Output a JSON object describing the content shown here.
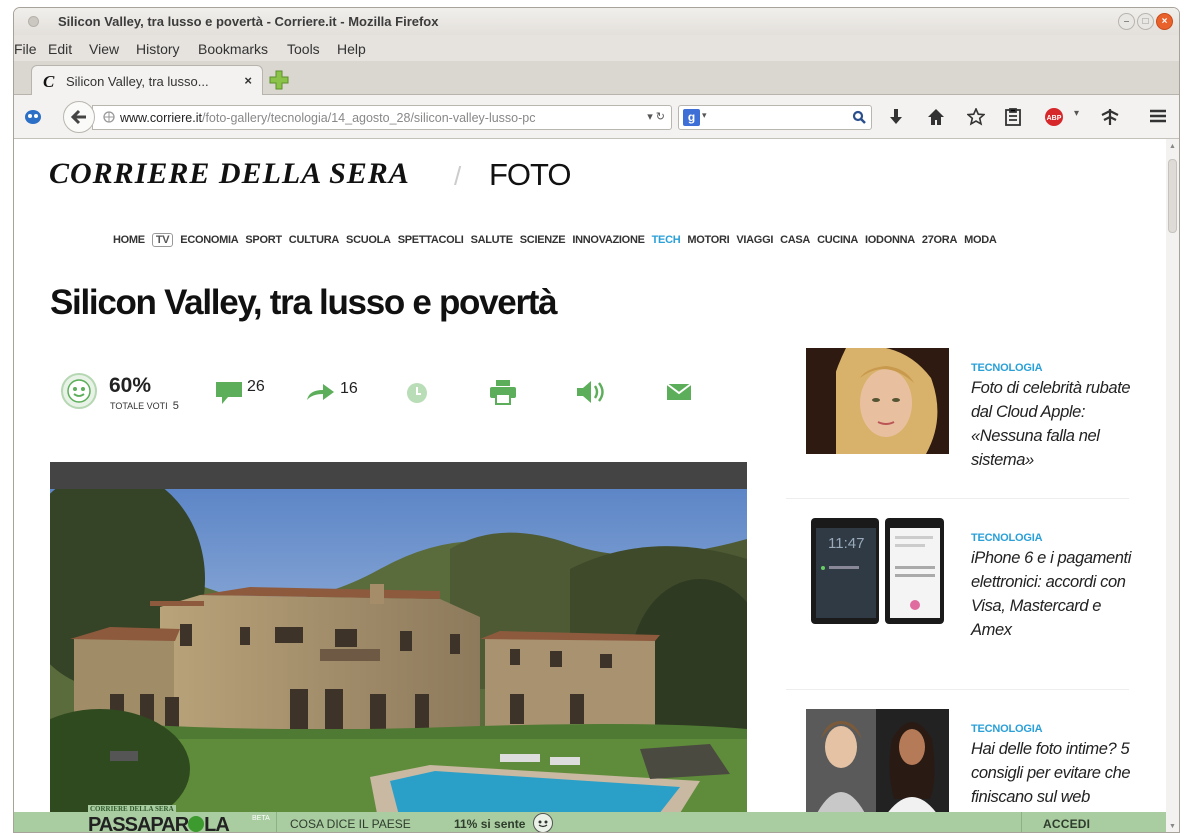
{
  "window": {
    "title": "Silicon Valley, tra lusso e povertà - Corriere.it - Mozilla Firefox"
  },
  "menu": [
    "File",
    "Edit",
    "View",
    "History",
    "Bookmarks",
    "Tools",
    "Help"
  ],
  "tab": {
    "title": "Silicon Valley, tra lusso...",
    "close": "×"
  },
  "address": {
    "domain": "www.corriere.it",
    "path": "/foto-gallery/tecnologia/14_agosto_28/silicon-valley-lusso-pc"
  },
  "page": {
    "masthead": "CORRIERE DELLA SERA",
    "separator": "/",
    "section": "FOTO",
    "nav": [
      "HOME",
      "TV",
      "ECONOMIA",
      "SPORT",
      "CULTURA",
      "SCUOLA",
      "SPETTACOLI",
      "SALUTE",
      "SCIENZE",
      "INNOVAZIONE",
      "TECH",
      "MOTORI",
      "VIAGGI",
      "CASA",
      "CUCINA",
      "IODONNA",
      "27ORA",
      "MODA"
    ],
    "headline": "Silicon Valley, tra lusso e povertà",
    "rating": {
      "percent": "60%",
      "votes_label": "TOTALE VOTI",
      "votes": "5"
    },
    "comments": "26",
    "shares": "16"
  },
  "sidebar": [
    {
      "category": "TECNOLOGIA",
      "title": "Foto di celebrità rubate dal Cloud Apple: «Nessuna falla nel sistema»"
    },
    {
      "category": "TECNOLOGIA",
      "title": "iPhone 6 e i pagamenti elettronici: accordi con Visa, Mastercard e Amex"
    },
    {
      "category": "TECNOLOGIA",
      "title": "Hai delle foto intime? 5 consigli per evitare che finiscano sul web"
    }
  ],
  "phone_time": "11:47",
  "passaparola": {
    "top": "CORRIERE DELLA SERA",
    "logo_a": "PASSAPAR",
    "logo_b": "LA",
    "beta": "BETA",
    "cosa": "COSA DICE IL PAESE",
    "pct": "11% si sente",
    "accedi": "ACCEDI"
  },
  "colors": {
    "accent": "#2aa0d8",
    "green": "#5cae5a",
    "bar": "#a9cca0"
  }
}
